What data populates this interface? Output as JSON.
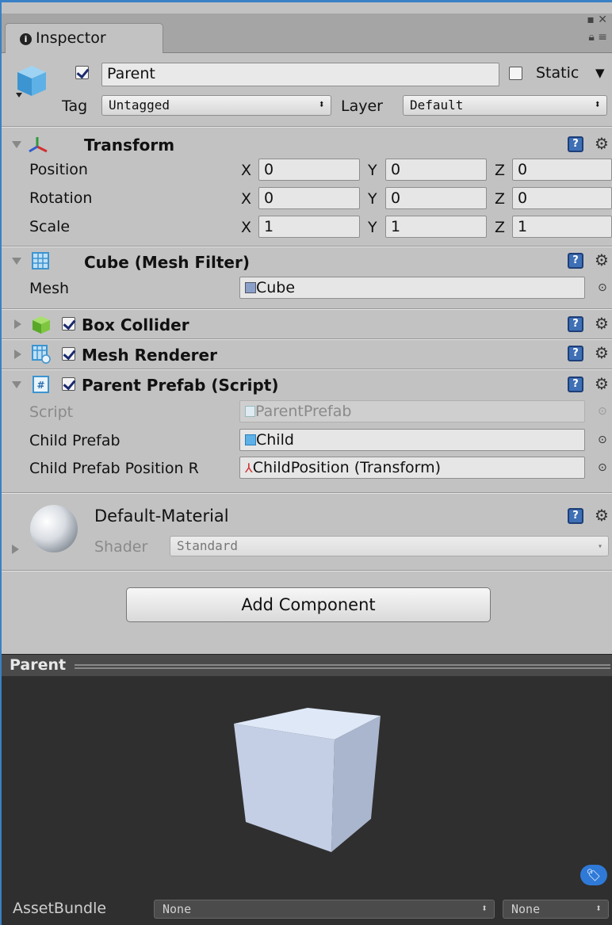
{
  "tab": {
    "title": "Inspector"
  },
  "object": {
    "name": "Parent",
    "active": true,
    "static_label": "Static",
    "static_checked": false,
    "tag_label": "Tag",
    "tag_value": "Untagged",
    "layer_label": "Layer",
    "layer_value": "Default"
  },
  "transform": {
    "title": "Transform",
    "rows": [
      {
        "label": "Position",
        "x": "0",
        "y": "0",
        "z": "0"
      },
      {
        "label": "Rotation",
        "x": "0",
        "y": "0",
        "z": "0"
      },
      {
        "label": "Scale",
        "x": "1",
        "y": "1",
        "z": "1"
      }
    ],
    "axis": {
      "x": "X",
      "y": "Y",
      "z": "Z"
    }
  },
  "mesh_filter": {
    "title": "Cube (Mesh Filter)",
    "mesh_label": "Mesh",
    "mesh_value": "Cube"
  },
  "box_collider": {
    "title": "Box Collider",
    "enabled": true
  },
  "mesh_renderer": {
    "title": "Mesh Renderer",
    "enabled": true
  },
  "parent_prefab": {
    "title": "Parent Prefab (Script)",
    "enabled": true,
    "script_label": "Script",
    "script_value": "ParentPrefab",
    "child_prefab_label": "Child Prefab",
    "child_prefab_value": "Child",
    "child_pos_label": "Child Prefab Position R",
    "child_pos_value": "ChildPosition (Transform)"
  },
  "material": {
    "name": "Default-Material",
    "shader_label": "Shader",
    "shader_value": "Standard"
  },
  "add_component_label": "Add Component",
  "preview": {
    "title": "Parent"
  },
  "assetbundle": {
    "label": "AssetBundle",
    "name_value": "None",
    "variant_value": "None"
  },
  "colors": {
    "accent": "#3a80c6",
    "help": "#3f6fb5",
    "cube": "#c7d3ea"
  }
}
